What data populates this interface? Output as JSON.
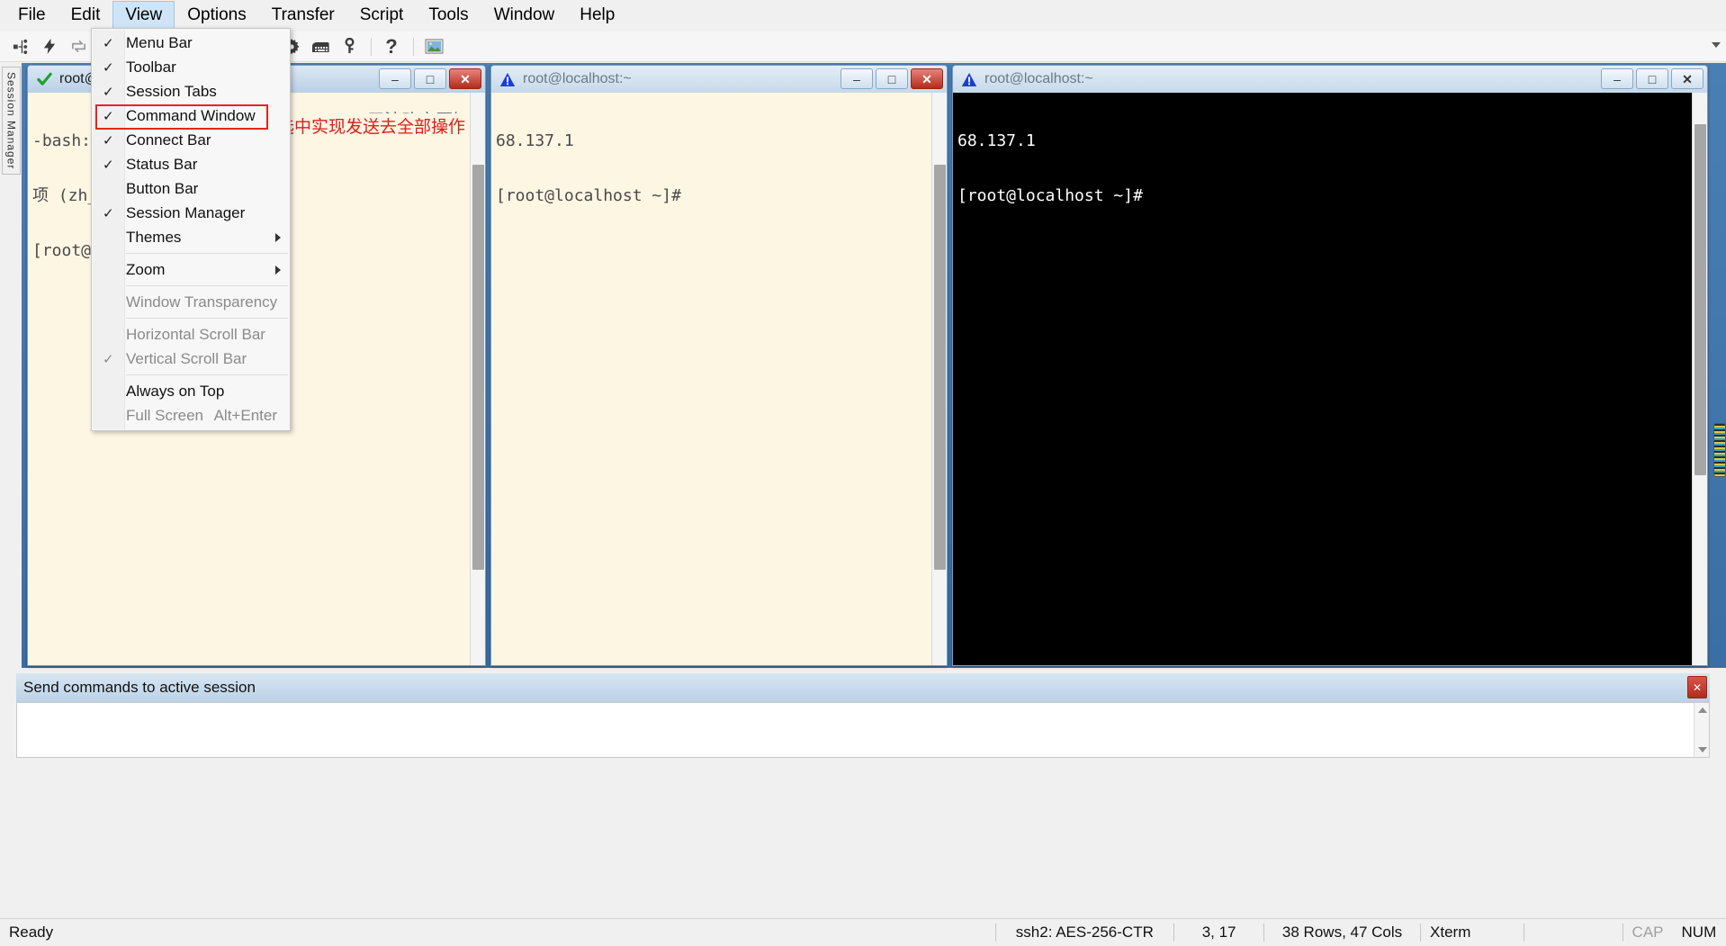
{
  "menubar": {
    "items": [
      {
        "label": "File"
      },
      {
        "label": "Edit"
      },
      {
        "label": "View"
      },
      {
        "label": "Options"
      },
      {
        "label": "Transfer"
      },
      {
        "label": "Script"
      },
      {
        "label": "Tools"
      },
      {
        "label": "Window"
      },
      {
        "label": "Help"
      }
    ],
    "active_index": 2
  },
  "toolbar": {
    "icons": [
      "connect-icon",
      "quick-connect-icon",
      "reconnect-icon",
      "connect-sftp-icon",
      "copy-icon",
      "paste-icon",
      "find-icon",
      "print-icon",
      "session-options-icon",
      "keymap-editor-icon",
      "key-icon",
      "help-icon",
      "image-icon"
    ]
  },
  "sidebar": {
    "session_manager_label": "Session Manager"
  },
  "view_menu": {
    "items": [
      {
        "label": "Menu Bar",
        "checked": true,
        "disabled": false,
        "submenu": false,
        "accel": "",
        "sep_after": false
      },
      {
        "label": "Toolbar",
        "checked": true,
        "disabled": false,
        "submenu": false,
        "accel": "",
        "sep_after": false
      },
      {
        "label": "Session Tabs",
        "checked": true,
        "disabled": false,
        "submenu": false,
        "accel": "",
        "sep_after": false
      },
      {
        "label": "Command Window",
        "checked": true,
        "disabled": false,
        "submenu": false,
        "accel": "",
        "sep_after": false
      },
      {
        "label": "Connect Bar",
        "checked": true,
        "disabled": false,
        "submenu": false,
        "accel": "",
        "sep_after": false
      },
      {
        "label": "Status Bar",
        "checked": true,
        "disabled": false,
        "submenu": false,
        "accel": "",
        "sep_after": false
      },
      {
        "label": "Button Bar",
        "checked": false,
        "disabled": false,
        "submenu": false,
        "accel": "",
        "sep_after": false
      },
      {
        "label": "Session Manager",
        "checked": true,
        "disabled": false,
        "submenu": false,
        "accel": "",
        "sep_after": false
      },
      {
        "label": "Themes",
        "checked": false,
        "disabled": false,
        "submenu": true,
        "accel": "",
        "sep_after": true
      },
      {
        "label": "Zoom",
        "checked": false,
        "disabled": false,
        "submenu": true,
        "accel": "",
        "sep_after": true
      },
      {
        "label": "Window Transparency",
        "checked": false,
        "disabled": true,
        "submenu": false,
        "accel": "",
        "sep_after": true
      },
      {
        "label": "Horizontal Scroll Bar",
        "checked": false,
        "disabled": true,
        "submenu": false,
        "accel": "",
        "sep_after": false
      },
      {
        "label": "Vertical Scroll Bar",
        "checked": true,
        "disabled": true,
        "submenu": false,
        "accel": "",
        "sep_after": true
      },
      {
        "label": "Always on Top",
        "checked": false,
        "disabled": false,
        "submenu": false,
        "accel": "",
        "sep_after": false
      },
      {
        "label": "Full Screen",
        "checked": false,
        "disabled": true,
        "submenu": false,
        "accel": "Alt+Enter",
        "sep_after": false
      }
    ],
    "highlighted_item": "Command Window",
    "highlight_color": "#e8231a",
    "check_glyph": "✓"
  },
  "windows": [
    {
      "title": "root@localhost:~",
      "status_icon": "green-check-icon",
      "active": true,
      "theme": "cream",
      "lines": [
        "-bash: ",
        "项 (zh_",
        "[root@r"
      ],
      "minimize_label": "–",
      "maximize_label": "□",
      "close_label": "✕"
    },
    {
      "title": "root@localhost:~",
      "status_icon": "warning-icon",
      "active": false,
      "theme": "cream",
      "lines": [
        "68.137.1",
        "[root@localhost ~]#"
      ],
      "minimize_label": "–",
      "maximize_label": "□",
      "close_label": "✕"
    },
    {
      "title": "root@localhost:~",
      "status_icon": "warning-icon",
      "active": false,
      "theme": "black",
      "lines": [
        "68.137.1",
        "[root@localhost ~]#"
      ],
      "minimize_label": "–",
      "maximize_label": "□",
      "close_label": "✕"
    }
  ],
  "window1_occluded_text": {
    "line1_tail": "E: 无法改变区域选",
    "annotation": "选中实现发送去全部操作"
  },
  "command_window": {
    "header_label": "Send commands to active session",
    "close_label": "✕",
    "input_value": "",
    "input_placeholder": ""
  },
  "statusbar": {
    "ready": "Ready",
    "cipher": "ssh2: AES-256-CTR",
    "position": "3, 17",
    "dimensions": "38 Rows, 47 Cols",
    "emulation": "Xterm",
    "cap": "CAP",
    "num": "NUM"
  }
}
